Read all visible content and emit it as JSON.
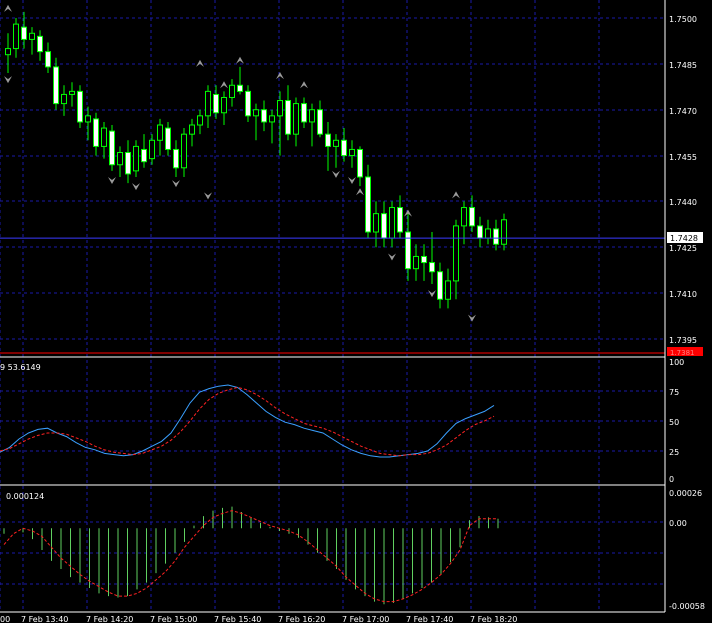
{
  "colors": {
    "background": "#000000",
    "grid": "#1a1aa8",
    "candle_up_body": "#000000",
    "candle_down_body": "#ffffff",
    "candle_wick": "#00ff00",
    "text": "#ffffff",
    "current_price_line": "#3b3bff",
    "current_price_box": "#ffffff",
    "red_marker": "#ff0000",
    "fractal_marker": "#9a9a9a",
    "stoch_main": "#3aa0ff",
    "stoch_signal": "#ff2222",
    "osc_hist": "#60d060",
    "osc_signal": "#ff2222",
    "separator": "#ffffff"
  },
  "price_axis": {
    "labels": [
      "1.7500",
      "1.7485",
      "1.7470",
      "1.7455",
      "1.7440",
      "1.7425",
      "1.7410",
      "1.7395"
    ],
    "current_price": "1.7428",
    "lower_marker": "1.7381"
  },
  "stoch_panel": {
    "header": "9  53.6149",
    "axis_labels": [
      "100",
      "75",
      "50",
      "25",
      "0"
    ]
  },
  "osc_panel": {
    "header": "0.000124",
    "axis_labels": [
      "0.00026",
      "0.00",
      "-0.00058"
    ]
  },
  "time_axis": {
    "labels": [
      "00",
      "7 Feb 13:40",
      "7 Feb 14:20",
      "7 Feb 15:00",
      "7 Feb 15:40",
      "7 Feb 16:20",
      "7 Feb 17:00",
      "7 Feb 17:40",
      "7 Feb 18:20"
    ]
  },
  "chart_data": [
    {
      "type": "candlestick",
      "title": "",
      "ylim": [
        1.7385,
        1.7515
      ],
      "candles": [
        [
          1.7488,
          1.7495,
          1.7482,
          1.749
        ],
        [
          1.749,
          1.75,
          1.7487,
          1.7498
        ],
        [
          1.7497,
          1.7502,
          1.749,
          1.7493
        ],
        [
          1.7493,
          1.7497,
          1.7488,
          1.7495
        ],
        [
          1.7494,
          1.7496,
          1.7486,
          1.7489
        ],
        [
          1.7489,
          1.7492,
          1.7482,
          1.7484
        ],
        [
          1.7484,
          1.7487,
          1.747,
          1.7472
        ],
        [
          1.7472,
          1.7478,
          1.7468,
          1.7475
        ],
        [
          1.7475,
          1.7479,
          1.7471,
          1.7476
        ],
        [
          1.7476,
          1.7478,
          1.7464,
          1.7466
        ],
        [
          1.7466,
          1.7471,
          1.746,
          1.7468
        ],
        [
          1.7467,
          1.7469,
          1.7455,
          1.7458
        ],
        [
          1.7458,
          1.7466,
          1.7454,
          1.7464
        ],
        [
          1.7463,
          1.7465,
          1.745,
          1.7452
        ],
        [
          1.7452,
          1.7458,
          1.7448,
          1.7456
        ],
        [
          1.7456,
          1.746,
          1.7446,
          1.7449
        ],
        [
          1.745,
          1.746,
          1.7448,
          1.7458
        ],
        [
          1.7457,
          1.7462,
          1.7451,
          1.7453
        ],
        [
          1.7454,
          1.7462,
          1.7452,
          1.746
        ],
        [
          1.746,
          1.7467,
          1.7455,
          1.7465
        ],
        [
          1.7464,
          1.7466,
          1.7455,
          1.7457
        ],
        [
          1.7457,
          1.746,
          1.7448,
          1.7451
        ],
        [
          1.7451,
          1.7464,
          1.7448,
          1.7462
        ],
        [
          1.7462,
          1.7467,
          1.7458,
          1.7465
        ],
        [
          1.7465,
          1.747,
          1.7462,
          1.7468
        ],
        [
          1.7468,
          1.7478,
          1.7464,
          1.7476
        ],
        [
          1.7475,
          1.7478,
          1.7467,
          1.7469
        ],
        [
          1.7469,
          1.7476,
          1.7465,
          1.7474
        ],
        [
          1.7474,
          1.748,
          1.7471,
          1.7478
        ],
        [
          1.7478,
          1.7484,
          1.7475,
          1.7476
        ],
        [
          1.7476,
          1.7478,
          1.7466,
          1.7468
        ],
        [
          1.7468,
          1.7472,
          1.746,
          1.747
        ],
        [
          1.747,
          1.7473,
          1.7463,
          1.7466
        ],
        [
          1.7466,
          1.747,
          1.7459,
          1.7468
        ],
        [
          1.7468,
          1.7476,
          1.7455,
          1.7473
        ],
        [
          1.7473,
          1.7478,
          1.746,
          1.7462
        ],
        [
          1.7462,
          1.7474,
          1.7458,
          1.7472
        ],
        [
          1.7472,
          1.7474,
          1.7464,
          1.7466
        ],
        [
          1.7466,
          1.7472,
          1.7458,
          1.747
        ],
        [
          1.747,
          1.7473,
          1.7461,
          1.7462
        ],
        [
          1.7462,
          1.7466,
          1.745,
          1.7458
        ],
        [
          1.7458,
          1.7462,
          1.7451,
          1.746
        ],
        [
          1.746,
          1.7464,
          1.7453,
          1.7455
        ],
        [
          1.7455,
          1.746,
          1.7451,
          1.7457
        ],
        [
          1.7457,
          1.7458,
          1.7445,
          1.7448
        ],
        [
          1.7448,
          1.7452,
          1.7428,
          1.743
        ],
        [
          1.743,
          1.744,
          1.7425,
          1.7436
        ],
        [
          1.7436,
          1.744,
          1.7425,
          1.7428
        ],
        [
          1.7428,
          1.744,
          1.7425,
          1.7438
        ],
        [
          1.7438,
          1.7442,
          1.7428,
          1.743
        ],
        [
          1.743,
          1.7436,
          1.7414,
          1.7418
        ],
        [
          1.7418,
          1.7426,
          1.7414,
          1.7422
        ],
        [
          1.7422,
          1.7426,
          1.7414,
          1.742
        ],
        [
          1.742,
          1.743,
          1.7413,
          1.7417
        ],
        [
          1.7417,
          1.742,
          1.7405,
          1.7408
        ],
        [
          1.7408,
          1.7418,
          1.7405,
          1.7414
        ],
        [
          1.7414,
          1.7434,
          1.7408,
          1.7432
        ],
        [
          1.7432,
          1.744,
          1.7426,
          1.7438
        ],
        [
          1.7438,
          1.7442,
          1.743,
          1.7432
        ],
        [
          1.7432,
          1.7435,
          1.7425,
          1.7428
        ],
        [
          1.7428,
          1.7434,
          1.7426,
          1.7431
        ],
        [
          1.7431,
          1.7434,
          1.7424,
          1.7426
        ],
        [
          1.7426,
          1.7436,
          1.7424,
          1.7434
        ]
      ],
      "fractals_up": [
        [
          0,
          1.7503
        ],
        [
          24,
          1.7485
        ],
        [
          27,
          1.7478
        ],
        [
          29,
          1.7486
        ],
        [
          34,
          1.7481
        ],
        [
          37,
          1.7478
        ],
        [
          44,
          1.7443
        ],
        [
          50,
          1.7436
        ],
        [
          56,
          1.7442
        ]
      ],
      "fractals_down": [
        [
          0,
          1.748
        ],
        [
          13,
          1.7447
        ],
        [
          16,
          1.7445
        ],
        [
          21,
          1.7446
        ],
        [
          25,
          1.7442
        ],
        [
          41,
          1.7449
        ],
        [
          43,
          1.7447
        ],
        [
          48,
          1.7422
        ],
        [
          53,
          1.741
        ],
        [
          58,
          1.7402
        ]
      ]
    },
    {
      "type": "line",
      "title": "",
      "ylim": [
        0,
        100
      ],
      "series": [
        {
          "values": [
            24,
            28,
            35,
            40,
            43,
            44,
            40,
            37,
            32,
            28,
            26,
            23,
            22,
            21,
            22,
            25,
            29,
            33,
            40,
            52,
            65,
            74,
            77,
            79,
            80,
            78,
            72,
            65,
            58,
            53,
            49,
            47,
            44,
            42,
            40,
            35,
            30,
            26,
            23,
            21,
            20,
            20,
            21,
            22,
            23,
            25,
            31,
            40,
            48,
            52,
            55,
            58,
            63
          ]
        },
        {
          "values": [
            25,
            27,
            31,
            35,
            38,
            40,
            40,
            39,
            36,
            33,
            29,
            26,
            24,
            23,
            22,
            23,
            26,
            29,
            34,
            41,
            50,
            60,
            68,
            73,
            76,
            78,
            76,
            72,
            67,
            61,
            56,
            52,
            48,
            46,
            44,
            41,
            37,
            33,
            29,
            26,
            23,
            22,
            21,
            22,
            22,
            23,
            26,
            30,
            36,
            42,
            47,
            50,
            54
          ]
        }
      ]
    },
    {
      "type": "bar",
      "title": "",
      "ylim": [
        -0.00058,
        0.00026
      ],
      "series": [
        {
          "values": [
            -4e-05,
            0.0,
            -3e-05,
            -8e-05,
            -0.00016,
            -0.00024,
            -0.0003,
            -0.00036,
            -0.0004,
            -0.00044,
            -0.00048,
            -0.0005,
            -0.00051,
            -0.0005,
            -0.00045,
            -0.0004,
            -0.00033,
            -0.00026,
            -0.00018,
            -0.0001,
            2e-05,
            9e-05,
            0.00013,
            0.00015,
            0.00016,
            0.00012,
            8e-05,
            4e-05,
            1e-05,
            -2e-05,
            -4e-05,
            -7e-05,
            -0.00012,
            -0.00018,
            -0.00024,
            -0.0003,
            -0.00038,
            -0.00045,
            -0.0005,
            -0.00054,
            -0.00056,
            -0.00055,
            -0.00052,
            -0.00048,
            -0.00044,
            -0.0004,
            -0.00034,
            -0.00025,
            -0.00014,
            6e-05,
            9e-05,
            8e-05,
            7e-05
          ]
        },
        {
          "values": [
            -0.00012,
            -4e-05,
            0.0,
            -2e-05,
            -6e-05,
            -0.00014,
            -0.00022,
            -0.00028,
            -0.00034,
            -0.00039,
            -0.00043,
            -0.00047,
            -0.0005,
            -0.0005,
            -0.00048,
            -0.00044,
            -0.00038,
            -0.00032,
            -0.00024,
            -0.00014,
            -6e-05,
            2e-05,
            8e-05,
            0.00011,
            0.00013,
            0.00011,
            8e-05,
            5e-05,
            2e-05,
            0.0,
            -2e-05,
            -5e-05,
            -0.0001,
            -0.00016,
            -0.00022,
            -0.00028,
            -0.00036,
            -0.00042,
            -0.00048,
            -0.00052,
            -0.00054,
            -0.00054,
            -0.00052,
            -0.00049,
            -0.00045,
            -0.0004,
            -0.00034,
            -0.00026,
            -0.00016,
            2e-05,
            7e-05,
            7e-05,
            7e-05
          ]
        }
      ]
    }
  ]
}
